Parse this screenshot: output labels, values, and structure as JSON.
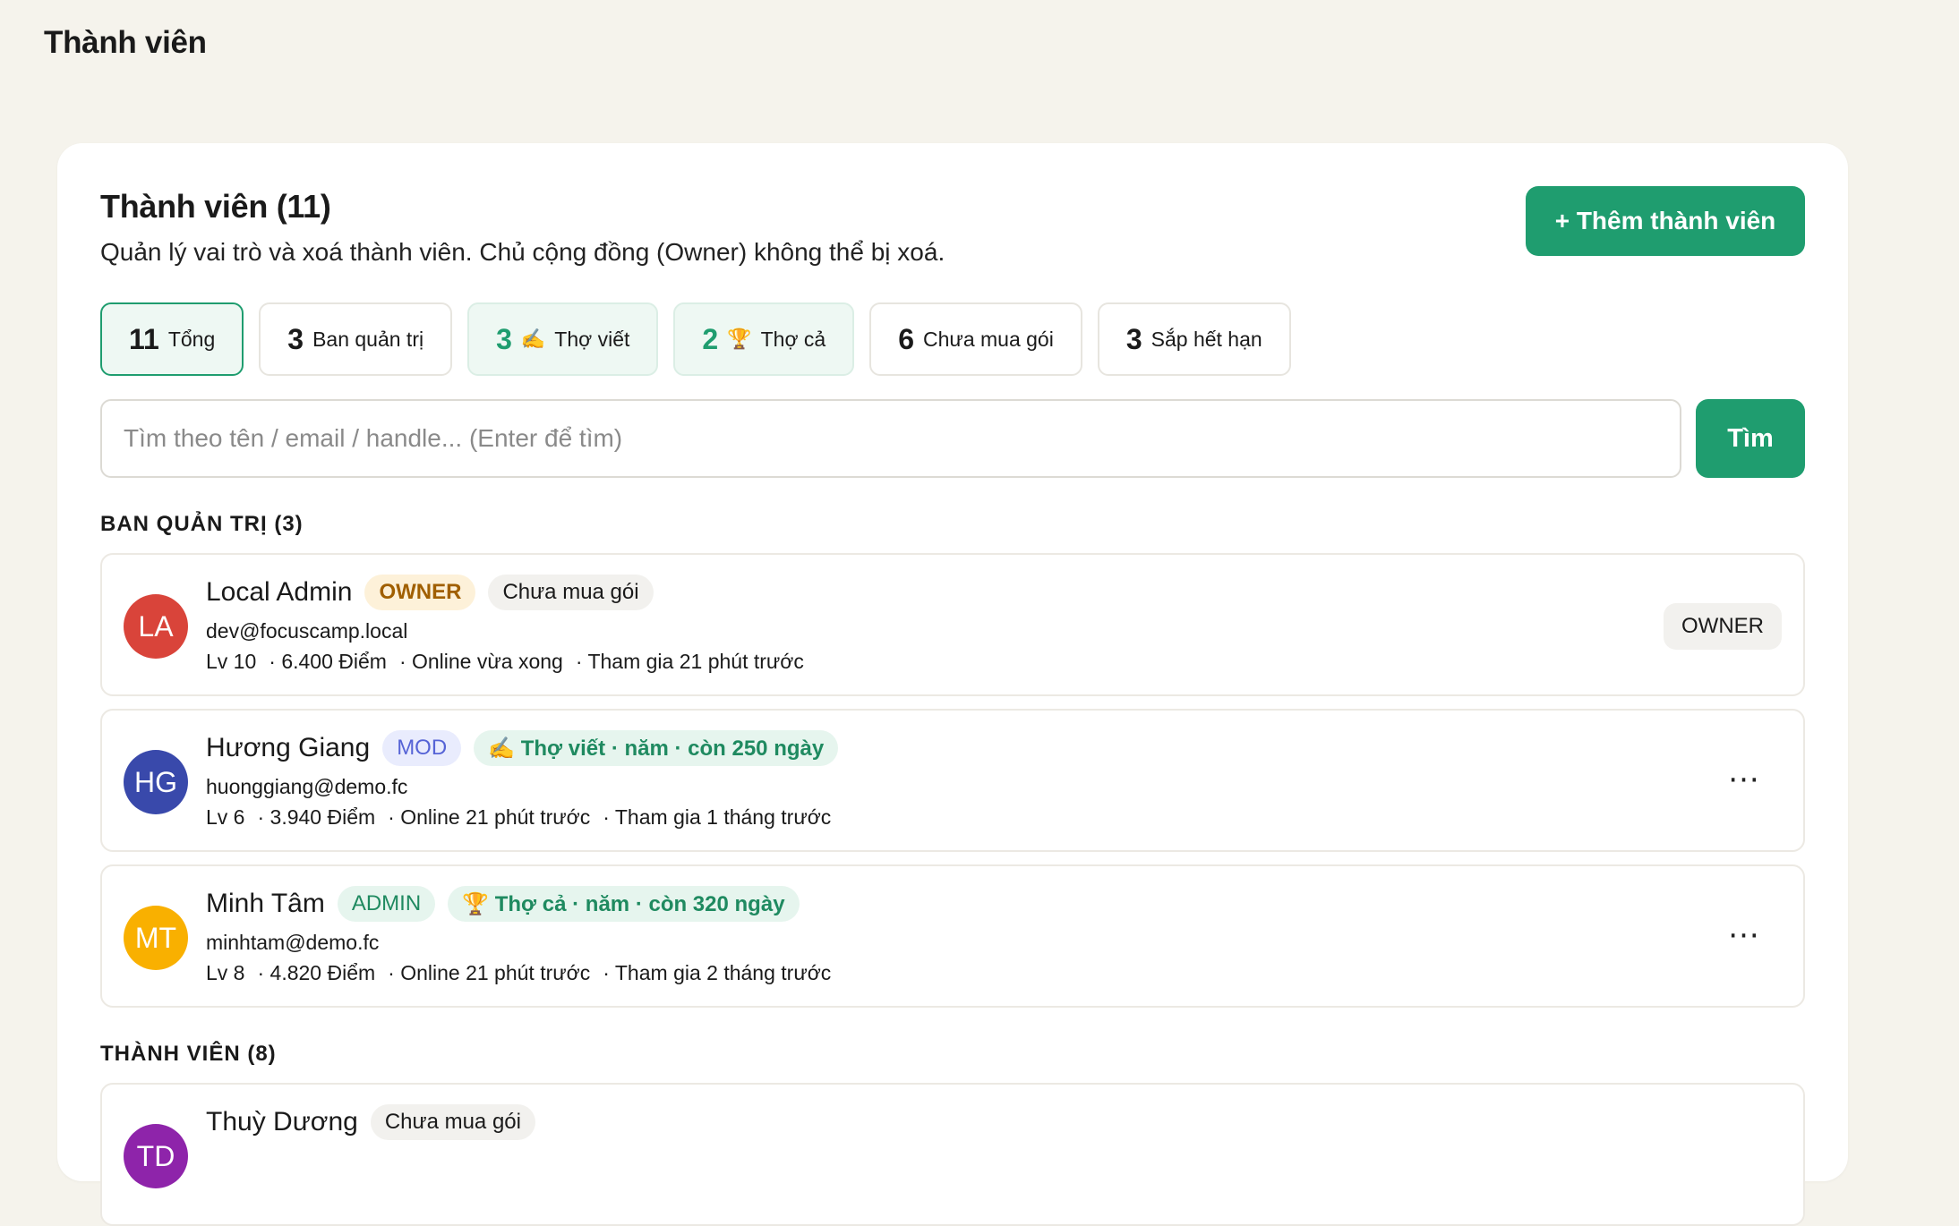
{
  "header": {
    "title": "Thành viên"
  },
  "card": {
    "title": "Thành viên (11)",
    "subtitle": "Quản lý vai trò và xoá thành viên. Chủ cộng đồng (Owner) không thể bị xoá.",
    "add_button": "+ Thêm thành viên"
  },
  "stats": [
    {
      "num": "11",
      "label": "Tổng",
      "emoji": ""
    },
    {
      "num": "3",
      "label": "Ban quản trị",
      "emoji": ""
    },
    {
      "num": "3",
      "label": "Thợ viết",
      "emoji": "✍️"
    },
    {
      "num": "2",
      "label": "Thợ cả",
      "emoji": "🏆"
    },
    {
      "num": "6",
      "label": "Chưa mua gói",
      "emoji": ""
    },
    {
      "num": "3",
      "label": "Sắp hết hạn",
      "emoji": ""
    }
  ],
  "search": {
    "placeholder": "Tìm theo tên / email / handle... (Enter để tìm)",
    "button": "Tìm"
  },
  "sections": {
    "admins": "BAN QUẢN TRỊ (3)",
    "members": "THÀNH VIÊN (8)"
  },
  "members": [
    {
      "initials": "LA",
      "color": "#d9443a",
      "name": "Local Admin",
      "role_pill": "OWNER",
      "plan_pill": "Chưa mua gói",
      "email": "dev@focuscamp.local",
      "level": "Lv 10",
      "points": "· 6.400 Điểm",
      "online": "· Online vừa xong",
      "joined": "· Tham gia 21 phút trước",
      "action": "OWNER"
    },
    {
      "initials": "HG",
      "color": "#3949ab",
      "name": "Hương Giang",
      "role_pill": "MOD",
      "plan_pill": "✍️ Thợ viết · năm · còn 250 ngày",
      "email": "huonggiang@demo.fc",
      "level": "Lv 6",
      "points": "· 3.940 Điểm",
      "online": "· Online 21 phút trước",
      "joined": "· Tham gia 1 tháng trước",
      "action": "···"
    },
    {
      "initials": "MT",
      "color": "#f9b000",
      "name": "Minh Tâm",
      "role_pill": "ADMIN",
      "plan_pill": "🏆 Thợ cả · năm · còn 320 ngày",
      "email": "minhtam@demo.fc",
      "level": "Lv 8",
      "points": "· 4.820 Điểm",
      "online": "· Online 21 phút trước",
      "joined": "· Tham gia 2 tháng trước",
      "action": "···"
    },
    {
      "initials": "TD",
      "color": "#8e24aa",
      "name": "Thuỳ Dương",
      "plan_pill": "Chưa mua gói"
    }
  ]
}
